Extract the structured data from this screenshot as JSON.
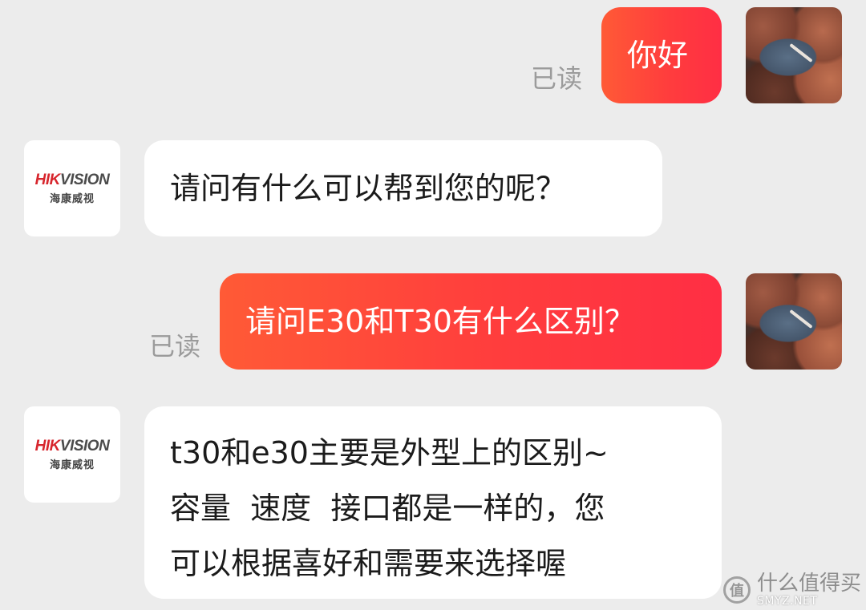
{
  "conversation": {
    "messages": [
      {
        "sender": "user",
        "text": "你好",
        "status": "已读"
      },
      {
        "sender": "brand",
        "lines": [
          "请问有什么可以帮到您的呢？"
        ]
      },
      {
        "sender": "user",
        "text": "请问E30和T30有什么区别？",
        "status": "已读"
      },
      {
        "sender": "brand",
        "lines": [
          "t30和e30主要是外型上的区别~",
          "容量  速度  接口都是一样的，您",
          "可以根据喜好和需要来选择喔"
        ]
      }
    ]
  },
  "brand_avatar": {
    "logo_red": "HIK",
    "logo_gray": "VISION",
    "name_cn": "海康威视"
  },
  "watermark": {
    "icon_text": "值",
    "text_cn": "什么值得买",
    "text_en": "SMYZ.NET"
  },
  "colors": {
    "outgoing_start": "#ff5a36",
    "outgoing_end": "#ff2e44",
    "incoming": "#ffffff",
    "background": "#ececec",
    "read_status": "#9b9b9b"
  }
}
